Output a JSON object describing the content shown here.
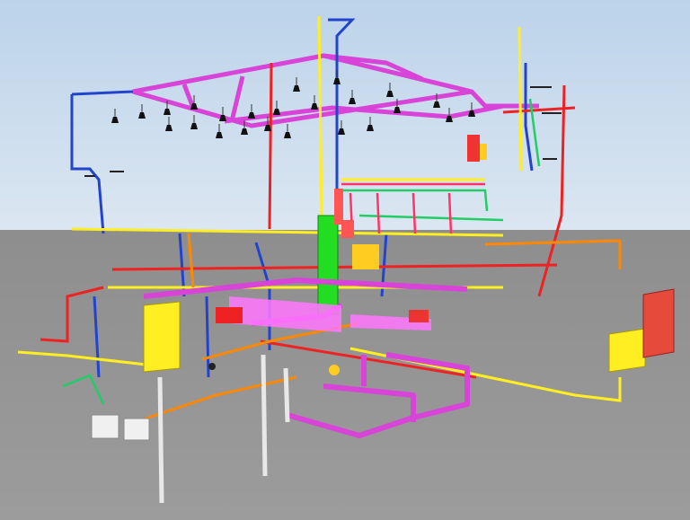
{
  "viewport": {
    "label": "",
    "colors": {
      "sky_top": "#bcd3ea",
      "sky_bottom": "#dbe6f1",
      "ground_top": "#8e8e8e",
      "ground_bottom": "#9c9c9c"
    }
  },
  "systems": [
    {
      "name": "ceiling-ventilation-duct",
      "color": "#d843d8"
    },
    {
      "name": "main-vertical-riser",
      "color": "#22dd22"
    },
    {
      "name": "supply-pipes",
      "color": "#ffee22"
    },
    {
      "name": "fire-protection-pipes",
      "color": "#ee2222"
    },
    {
      "name": "cold-water-pipes",
      "color": "#2244cc"
    },
    {
      "name": "drain-pipes",
      "color": "#ff8800"
    },
    {
      "name": "heat-pipes",
      "color": "#ff3366"
    },
    {
      "name": "condensate-pipes",
      "color": "#22cc66"
    },
    {
      "name": "exhaust-duct",
      "color": "#ff55ff"
    },
    {
      "name": "support-columns",
      "color": "#e8e8e8"
    }
  ],
  "equipment": [
    {
      "name": "yellow-electrical-cabinet",
      "color": "#ffee22"
    },
    {
      "name": "red-electrical-cabinet",
      "color": "#e64a3a"
    },
    {
      "name": "pump-unit",
      "color": "#f0f0f0"
    }
  ],
  "fixtures": {
    "pendant_lamp_icon": "pendant-lamp-icon",
    "count": 24
  }
}
